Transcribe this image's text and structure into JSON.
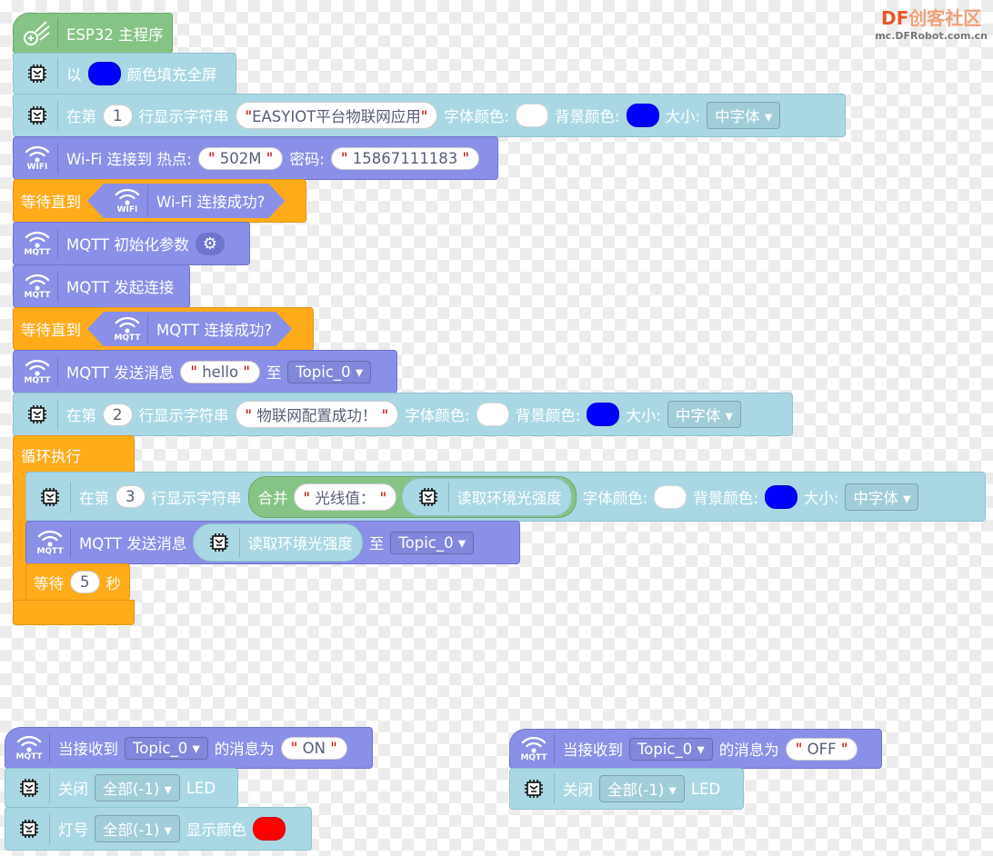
{
  "watermark": {
    "brand_df": "DF",
    "brand_cn": "创客社区",
    "url": "mc.DFRobot.com.cn"
  },
  "colors": {
    "controls": "#86c486",
    "screen": "#a9d8e4",
    "network": "#8a8fe7",
    "control_flow": "#ffab1a",
    "blue": "#0000ff",
    "white": "#ffffff",
    "red": "#ff0000"
  },
  "icon_labels": {
    "wifi": "WIFI",
    "mqtt": "MQTT"
  },
  "main": {
    "title": "ESP32 主程序"
  },
  "fill": {
    "pre": "以",
    "post": "颜色填充全屏"
  },
  "line1": {
    "a": "在第",
    "row": "1",
    "b": "行显示字符串",
    "text": "EASYIOT平台物联网应用",
    "font_color": "字体颜色:",
    "bg_color": "背景颜色:",
    "size": "大小:",
    "size_value": "中字体"
  },
  "wifi": {
    "a": "Wi-Fi 连接到 热点:",
    "ssid": "502M",
    "pwd_label": "密码:",
    "pwd": "15867111183"
  },
  "wait1": {
    "label": "等待直到",
    "cond": "Wi-Fi 连接成功?"
  },
  "mqtt_init": {
    "label": "MQTT 初始化参数"
  },
  "mqtt_connect": {
    "label": "MQTT 发起连接"
  },
  "wait2": {
    "label": "等待直到",
    "cond": "MQTT 连接成功?"
  },
  "send1": {
    "label": "MQTT 发送消息",
    "msg": "hello",
    "to": "至",
    "topic": "Topic_0"
  },
  "line2": {
    "a": "在第",
    "row": "2",
    "b": "行显示字符串",
    "text": "物联网配置成功！",
    "font_color": "字体颜色:",
    "bg_color": "背景颜色:",
    "size": "大小:",
    "size_value": "中字体"
  },
  "loop": {
    "label": "循环执行"
  },
  "line3": {
    "a": "在第",
    "row": "3",
    "b": "行显示字符串",
    "join": "合并",
    "text": "光线值：",
    "sensor": "读取环境光强度",
    "font_color": "字体颜色:",
    "bg_color": "背景颜色:",
    "size": "大小:",
    "size_value": "中字体"
  },
  "send2": {
    "label": "MQTT 发送消息",
    "sensor": "读取环境光强度",
    "to": "至",
    "topic": "Topic_0"
  },
  "wait3": {
    "a": "等待",
    "secs": "5",
    "b": "秒"
  },
  "on_handler": {
    "a": "当接收到",
    "topic": "Topic_0",
    "b": "的消息为",
    "msg": "ON",
    "off_a": "关闭",
    "off_sel": "全部(-1)",
    "off_b": "LED",
    "led_a": "灯号",
    "led_sel": "全部(-1)",
    "led_b": "显示颜色"
  },
  "off_handler": {
    "a": "当接收到",
    "topic": "Topic_0",
    "b": "的消息为",
    "msg": "OFF",
    "off_a": "关闭",
    "off_sel": "全部(-1)",
    "off_b": "LED"
  }
}
